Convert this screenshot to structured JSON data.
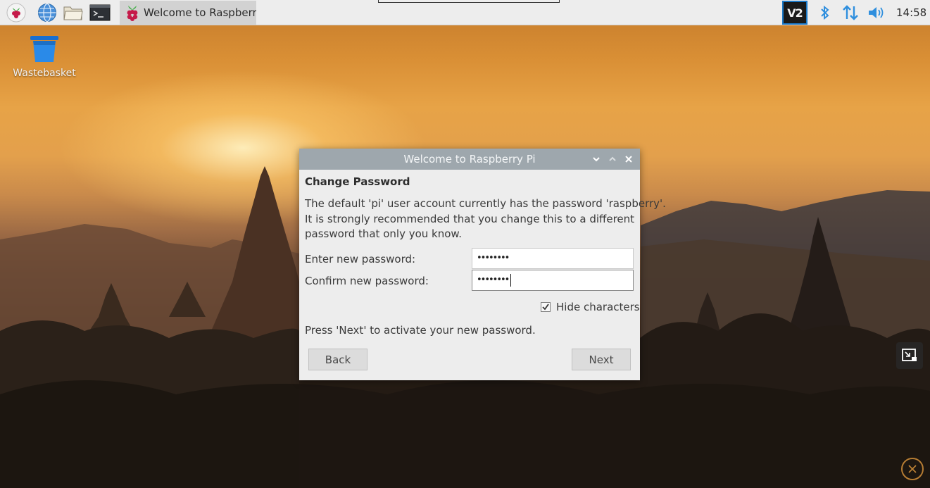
{
  "taskbar": {
    "active_window_label": "Welcome to Raspberr...",
    "clock": "14:58",
    "icons": [
      "raspberry-menu-icon",
      "web-browser-icon",
      "file-manager-icon",
      "terminal-icon",
      "vnc-icon",
      "bluetooth-icon",
      "network-icon",
      "volume-icon"
    ],
    "vnc_label": "V2"
  },
  "desktop": {
    "wastebasket_label": "Wastebasket"
  },
  "dialog": {
    "title": "Welcome to Raspberry Pi",
    "heading": "Change Password",
    "description_lines": [
      "The default 'pi' user account currently has the password 'raspberry'.",
      "It is strongly recommended that you change this to a different",
      "password that only you know."
    ],
    "new_password_label": "Enter new password:",
    "new_password_value": "••••••••",
    "confirm_password_label": "Confirm new password:",
    "confirm_password_value": "••••••••",
    "hide_characters_label": "Hide characters",
    "hide_characters_checked": true,
    "hint": "Press 'Next' to activate your new password.",
    "back_label": "Back",
    "next_label": "Next"
  },
  "colors": {
    "panel": "#ededed",
    "titlebar": "#9ea7ad",
    "vnc_accent": "#1b78c6",
    "status_icon_blue": "#2f8fde"
  }
}
